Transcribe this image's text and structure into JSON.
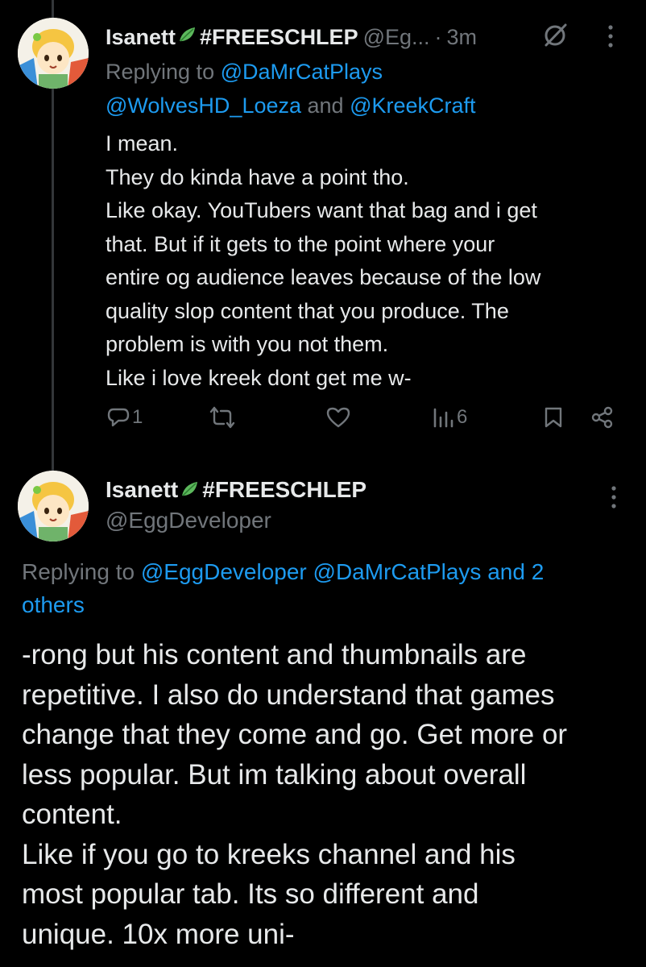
{
  "tweet1": {
    "display_name": "Isanett",
    "display_name_suffix": "#FREESCHLEP",
    "handle": "@Eg...",
    "separator": "·",
    "time": "3m",
    "replying_prefix": "Replying to ",
    "replying_user1": "@DaMrCatPlays",
    "replying_user2": "@WolvesHD_Loeza",
    "replying_and": " and ",
    "replying_user3": "@KreekCraft",
    "body_lines": [
      "I mean.",
      "They do kinda have a point tho.",
      "Like okay. YouTubers want that bag and i get",
      "that. But if it gets to the point where your",
      "entire og audience leaves because of the low",
      "quality slop content that you produce. The",
      "problem is with you not them.",
      "Like i love kreek dont get me w-"
    ],
    "actions": {
      "reply_count": "1",
      "retweet_count": "",
      "like_count": "",
      "views_count": "6"
    }
  },
  "tweet2": {
    "display_name": "Isanett",
    "display_name_suffix": "#FREESCHLEP",
    "handle": "@EggDeveloper",
    "replying_prefix": "Replying to ",
    "replying_users": "@EggDeveloper @DaMrCatPlays and 2",
    "replying_others": "others",
    "body_lines": [
      "-rong but his content and thumbnails are",
      "repetitive. I also do understand that games",
      "change that they come and go. Get more or",
      "less popular. But im talking about overall",
      "content.",
      "Like if you go to kreeks channel and his",
      "most popular tab. Its so different and",
      "unique. 10x more uni-"
    ]
  },
  "icons": {
    "avatar": "anime-avatar",
    "name_emoji": "herb-leaf-icon",
    "grok": "grok-icon",
    "more": "more-vertical-icon",
    "reply": "reply-icon",
    "retweet": "retweet-icon",
    "like": "heart-icon",
    "views": "views-icon",
    "bookmark": "bookmark-icon",
    "share": "share-icon"
  },
  "colors": {
    "background": "#000000",
    "text": "#e7e9ea",
    "secondary": "#71767b",
    "link": "#1d9bf0",
    "thread_line": "#333639"
  }
}
